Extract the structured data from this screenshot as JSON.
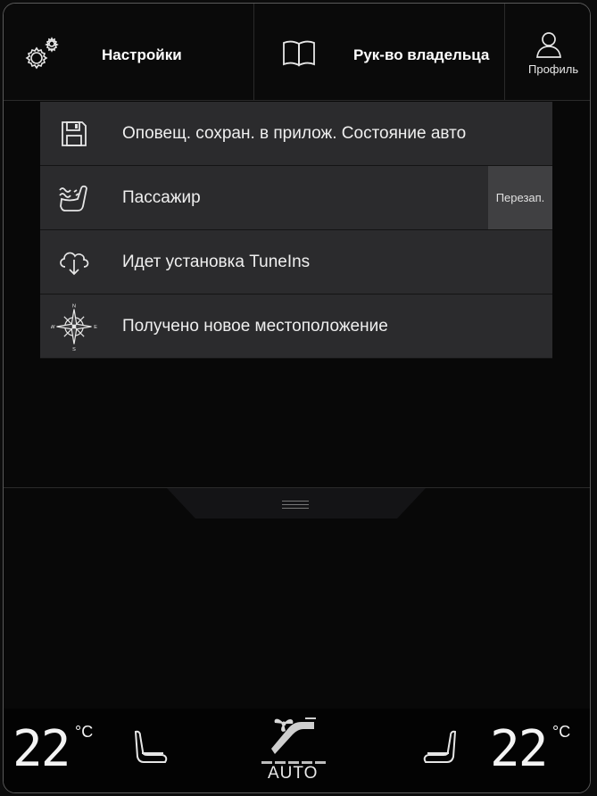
{
  "header": {
    "settings_label": "Настройки",
    "manual_label": "Рук-во владельца",
    "profile_label": "Профиль"
  },
  "notifications": [
    {
      "icon": "floppy-disk-icon",
      "text": "Оповещ. сохран. в прилож. Состояние авто",
      "action": ""
    },
    {
      "icon": "seat-heat-icon",
      "text": "Пассажир",
      "action": "Перезап."
    },
    {
      "icon": "cloud-download-icon",
      "text": "Идет установка TuneIns",
      "action": ""
    },
    {
      "icon": "compass-icon",
      "text": "Получено новое местоположение",
      "action": ""
    }
  ],
  "compass": {
    "n": "N",
    "e": "E",
    "s": "S",
    "w": "W"
  },
  "climate": {
    "left_temp": "22",
    "right_temp": "22",
    "unit": "°C",
    "auto_label": "AUTO"
  }
}
